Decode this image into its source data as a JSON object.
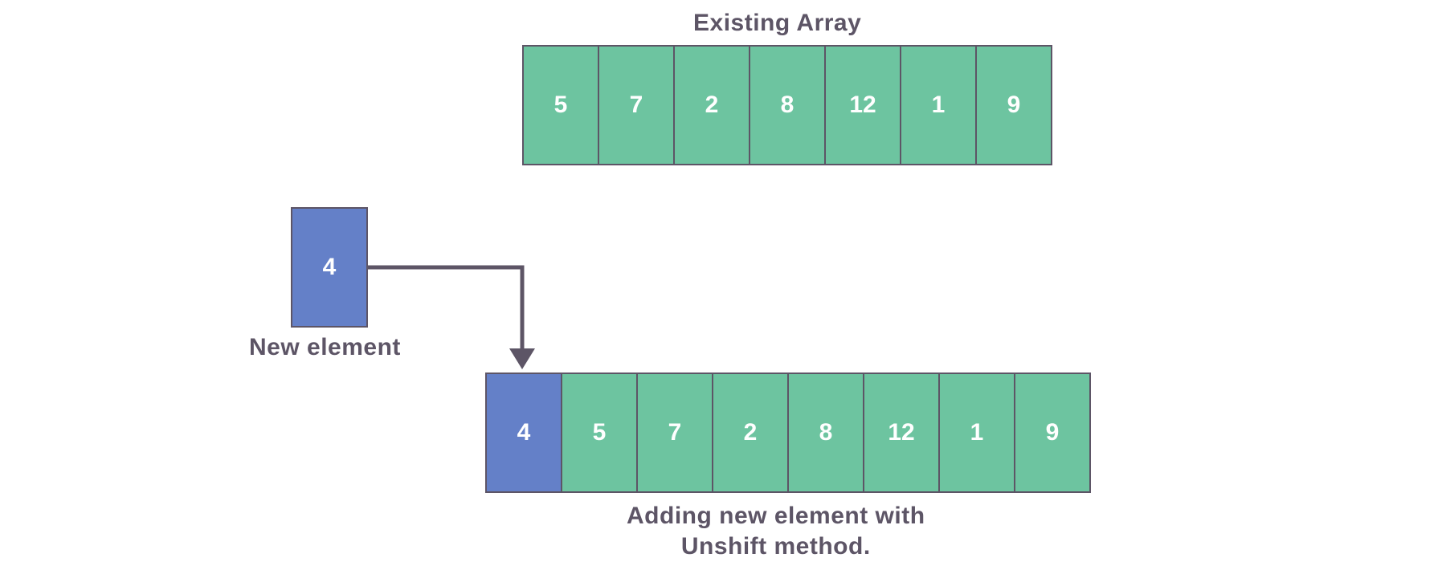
{
  "labels": {
    "existing": "Existing Array",
    "newElement": "New element",
    "result": "Adding new element with\nUnshift method."
  },
  "existingArray": [
    "5",
    "7",
    "2",
    "8",
    "12",
    "1",
    "9"
  ],
  "newElement": "4",
  "resultArray": [
    {
      "value": "4",
      "color": "blue"
    },
    {
      "value": "5",
      "color": "green"
    },
    {
      "value": "7",
      "color": "green"
    },
    {
      "value": "2",
      "color": "green"
    },
    {
      "value": "8",
      "color": "green"
    },
    {
      "value": "12",
      "color": "green"
    },
    {
      "value": "1",
      "color": "green"
    },
    {
      "value": "9",
      "color": "green"
    }
  ],
  "colors": {
    "green": "#6dc4a0",
    "blue": "#6480c8",
    "text": "#5d5566",
    "border": "#5d5566"
  }
}
